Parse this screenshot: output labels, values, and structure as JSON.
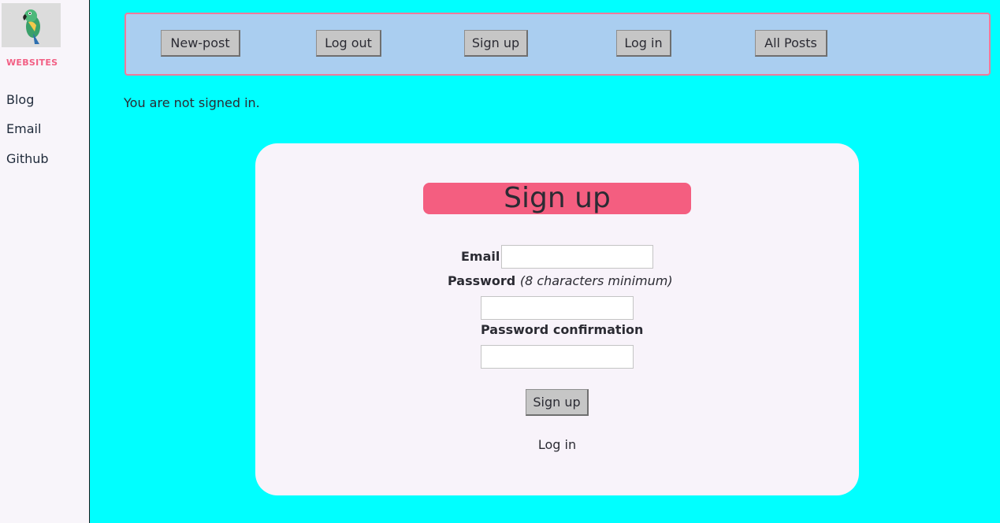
{
  "sidebar": {
    "logo_icon": "parrot-icon",
    "section_label": "WEBSITES",
    "links": [
      "Blog",
      "Email",
      "Github"
    ]
  },
  "nav": {
    "buttons": [
      "New-post",
      "Log out",
      "Sign up",
      "Log in",
      "All Posts"
    ]
  },
  "status": "You are not signed in.",
  "form": {
    "title": "Sign up",
    "email_label": "Email",
    "email_value": "",
    "password_label": "Password",
    "password_hint": "(8 characters minimum)",
    "password_value": "",
    "confirm_label": "Password confirmation",
    "confirm_value": "",
    "submit_label": "Sign up",
    "login_link": "Log in"
  },
  "colors": {
    "page_bg": "#00ffff",
    "sidebar_bg": "#f8f5fa",
    "accent_pink": "#f45e80",
    "nav_bg": "#aacef0",
    "card_bg": "#f8f3fa",
    "button_bg": "#c6c6c6"
  }
}
